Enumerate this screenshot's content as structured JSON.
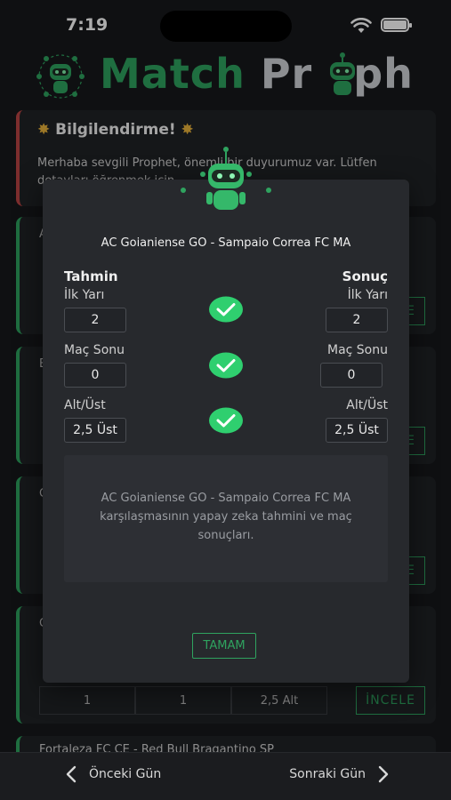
{
  "status_bar": {
    "time": "7:19"
  },
  "header": {
    "logo_part1": "Match",
    "logo_part2": "Pr",
    "logo_part3": "ph"
  },
  "notice": {
    "title": "Bilgilendirme!",
    "text_line1": "Merhaba sevgili Prophet, önemli bir duyurumuz var. Lütfen",
    "text_line2": "detayları öğrenmek için..."
  },
  "background_cards": [
    {
      "title": "A",
      "cells": [
        "",
        "",
        ""
      ],
      "button": "İNCELE"
    },
    {
      "title": "B",
      "cells": [
        "",
        "",
        ""
      ],
      "button": "İNCELE"
    },
    {
      "title": "C",
      "cells": [
        "",
        "",
        ""
      ],
      "button": "İNCELE"
    },
    {
      "title": "C",
      "cells": [
        "1",
        "1",
        "2,5 Alt"
      ],
      "button": "İNCELE"
    }
  ],
  "last_card_title": "Fortaleza FC CE - Red Bull Bragantino SP",
  "modal": {
    "match_title": "AC Goianiense GO - Sampaio Correa FC MA",
    "prediction_header": "Tahmin",
    "result_header": "Sonuç",
    "rows": [
      {
        "label": "İlk Yarı",
        "prediction": "2",
        "result": "2",
        "correct": true
      },
      {
        "label": "Maç Sonu",
        "prediction": "0",
        "result": "0",
        "correct": true
      },
      {
        "label": "Alt/Üst",
        "prediction": "2,5 Üst",
        "result": "2,5 Üst",
        "correct": true
      }
    ],
    "description": "AC Goianiense GO - Sampaio Correa FC MA karşılaşmasının yapay zeka tahmini ve maç sonuçları.",
    "ok_label": "TAMAM"
  },
  "bottom_nav": {
    "prev_label": "Önceki Gün",
    "next_label": "Sonraki Gün"
  },
  "colors": {
    "accent": "#2fa35f",
    "check": "#2fcf6f",
    "warning_border": "#b94444"
  }
}
